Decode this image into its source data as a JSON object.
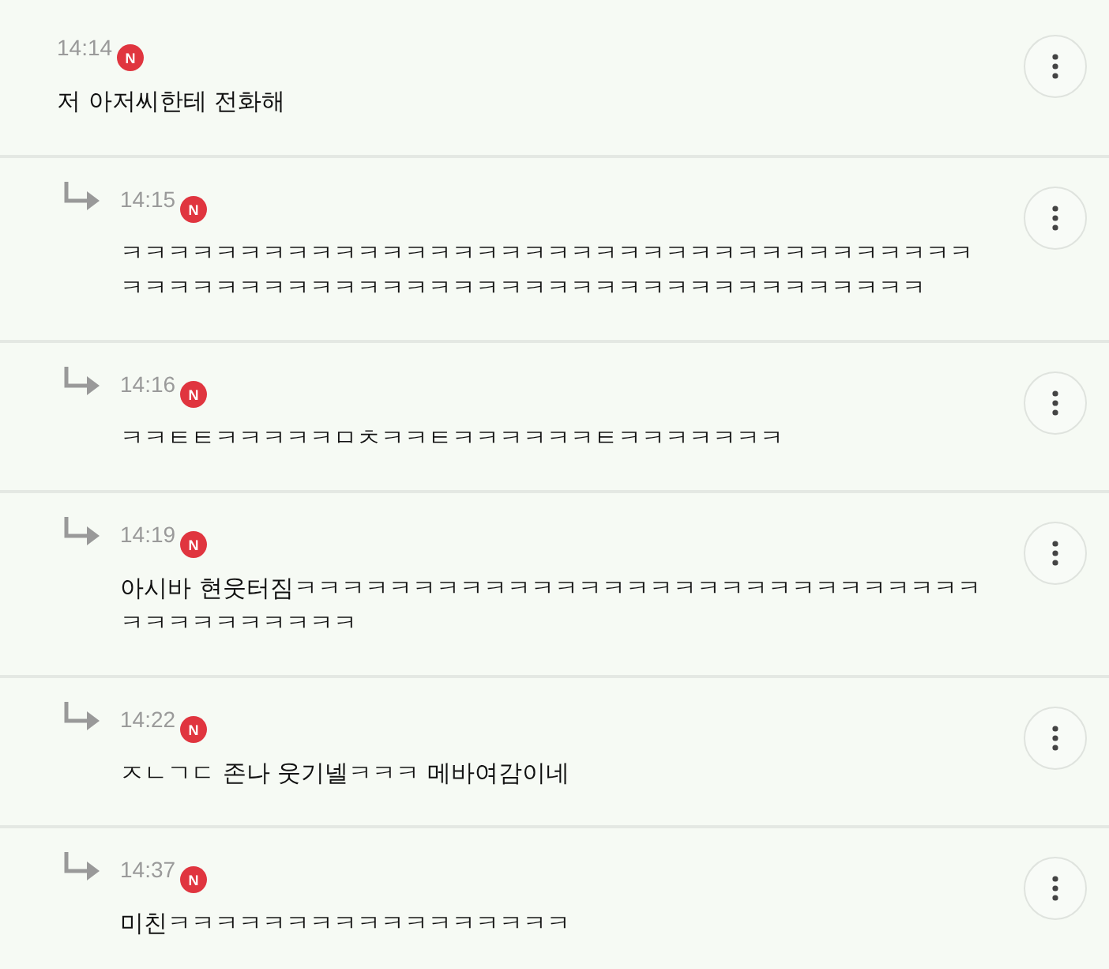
{
  "comments": [
    {
      "kind": "comment",
      "time": "14:14",
      "badge": "N",
      "text": "저 아저씨한테 전화해"
    },
    {
      "kind": "reply",
      "time": "14:15",
      "badge": "N",
      "text": "ㅋㅋㅋㅋㅋㅋㅋㅋㅋㅋㅋㅋㅋㅋㅋㅋㅋㅋㅋㅋㅋㅋㅋㅋㅋㅋㅋㅋㅋㅋㅋㅋㅋㅋㅋㅋㅋㅋㅋㅋㅋㅋㅋㅋㅋㅋㅋㅋㅋㅋㅋㅋㅋㅋㅋㅋㅋㅋㅋㅋㅋㅋㅋㅋㅋㅋㅋㅋㅋㅋ"
    },
    {
      "kind": "reply",
      "time": "14:16",
      "badge": "N",
      "text": "ㅋㅋㅌㅌㅋㅋㅋㅋㅋㅁㅊㅋㅋㅌㅋㅋㅋㅋㅋㅋㅌㅋㅋㅋㅋㅋㅋㅋ"
    },
    {
      "kind": "reply",
      "time": "14:19",
      "badge": "N",
      "text": "아시바 현웃터짐ㅋㅋㅋㅋㅋㅋㅋㅋㅋㅋㅋㅋㅋㅋㅋㅋㅋㅋㅋㅋㅋㅋㅋㅋㅋㅋㅋㅋㅋㅋㅋㅋㅋㅋㅋㅋㅋㅋㅋ"
    },
    {
      "kind": "reply",
      "time": "14:22",
      "badge": "N",
      "text": "ㅈㄴㄱㄷ 존나 웃기넬ㅋㅋㅋ 메바여감이네"
    },
    {
      "kind": "reply",
      "time": "14:37",
      "badge": "N",
      "text": "미친ㅋㅋㅋㅋㅋㅋㅋㅋㅋㅋㅋㅋㅋㅋㅋㅋㅋ"
    }
  ]
}
